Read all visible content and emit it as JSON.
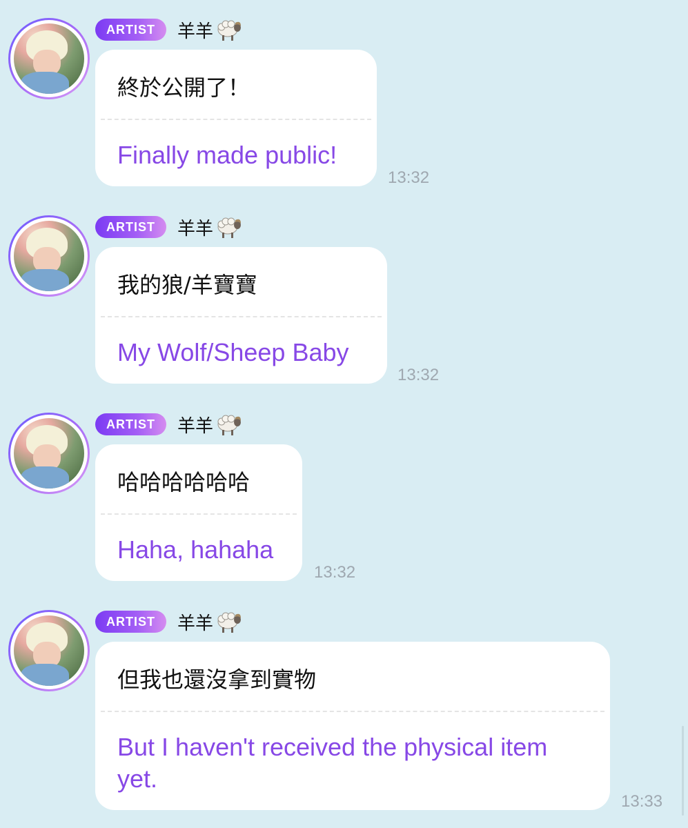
{
  "messages": [
    {
      "badge": "ARTIST",
      "sender": "羊羊",
      "sender_icon": "sheep-emoji",
      "original": "終於公開了！",
      "translation": "Finally made public!",
      "time": "13:32"
    },
    {
      "badge": "ARTIST",
      "sender": "羊羊",
      "sender_icon": "sheep-emoji",
      "original": "我的狼/羊寶寶",
      "translation": "My Wolf/Sheep Baby",
      "time": "13:32"
    },
    {
      "badge": "ARTIST",
      "sender": "羊羊",
      "sender_icon": "sheep-emoji",
      "original": "哈哈哈哈哈哈",
      "translation": "Haha, hahaha",
      "time": "13:32"
    },
    {
      "badge": "ARTIST",
      "sender": "羊羊",
      "sender_icon": "sheep-emoji",
      "original": "但我也還沒拿到實物",
      "translation": "But I haven't received the physical item yet.",
      "time": "13:33"
    }
  ],
  "colors": {
    "background": "#d9edf3",
    "badge_gradient_start": "#7b3bf3",
    "badge_gradient_end": "#d58cf0",
    "translation_text": "#8748e6",
    "timestamp": "#9fa8b0"
  }
}
